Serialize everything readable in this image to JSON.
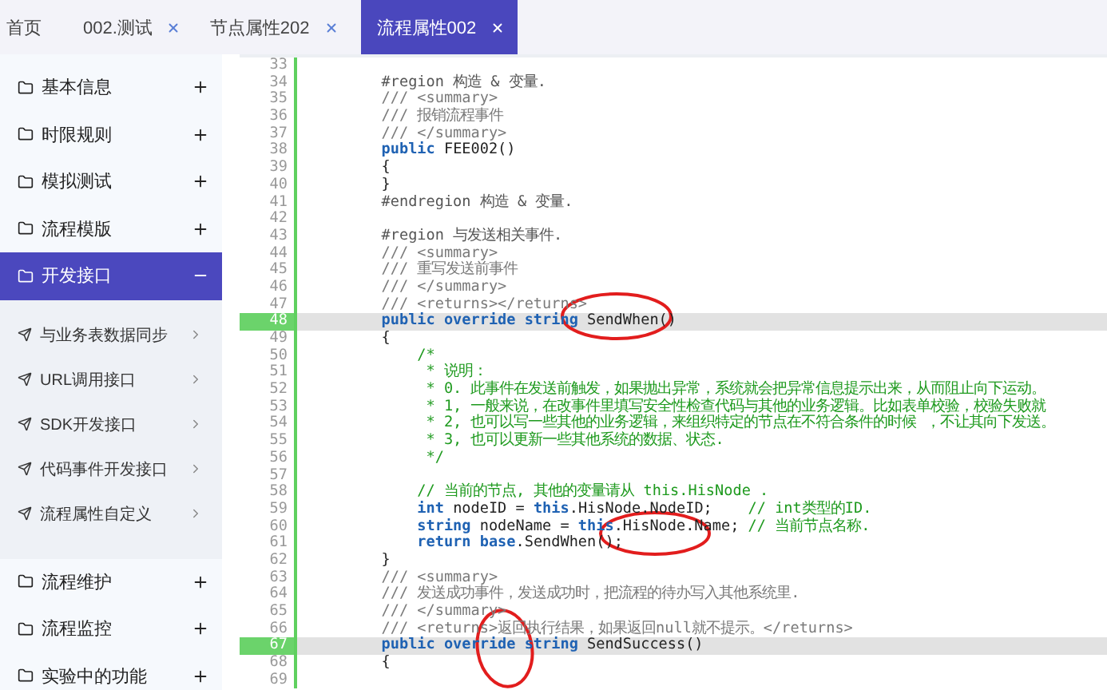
{
  "tabs": [
    {
      "label": "首页",
      "selected": false,
      "closable": false
    },
    {
      "label": "002.测试",
      "selected": false,
      "closable": true
    },
    {
      "label": "节点属性202",
      "selected": false,
      "closable": true
    },
    {
      "label": "流程属性002",
      "selected": true,
      "closable": true
    }
  ],
  "sidebar": {
    "items": [
      {
        "label": "基本信息",
        "expanded": false
      },
      {
        "label": "时限规则",
        "expanded": false
      },
      {
        "label": "模拟测试",
        "expanded": false
      },
      {
        "label": "流程模版",
        "expanded": false
      },
      {
        "label": "开发接口",
        "expanded": true,
        "children": [
          {
            "label": "与业务表数据同步"
          },
          {
            "label": "URL调用接口"
          },
          {
            "label": "SDK开发接口"
          },
          {
            "label": "代码事件开发接口"
          },
          {
            "label": "流程属性自定义"
          }
        ]
      },
      {
        "label": "流程维护",
        "expanded": false
      },
      {
        "label": "流程监控",
        "expanded": false
      },
      {
        "label": "实验中的功能",
        "expanded": false
      }
    ]
  },
  "code": {
    "lines": [
      {
        "number": "33",
        "highlighted": false
      },
      {
        "number": "34",
        "highlighted": false,
        "segments": [
          {
            "kind": "directive",
            "text": "        #region 构造 & 变量."
          }
        ]
      },
      {
        "number": "35",
        "highlighted": false,
        "segments": [
          {
            "kind": "doc",
            "text": "        /// <summary>"
          }
        ]
      },
      {
        "number": "36",
        "highlighted": false,
        "segments": [
          {
            "kind": "doc",
            "text": "        /// 报销流程事件"
          }
        ]
      },
      {
        "number": "37",
        "highlighted": false,
        "segments": [
          {
            "kind": "doc",
            "text": "        /// </summary>"
          }
        ]
      },
      {
        "number": "38",
        "highlighted": false,
        "segments": [
          {
            "kind": "keyword",
            "text": "        public"
          },
          {
            "kind": "plain",
            "text": " FEE002()"
          }
        ]
      },
      {
        "number": "39",
        "highlighted": false,
        "segments": [
          {
            "kind": "plain",
            "text": "        {"
          }
        ]
      },
      {
        "number": "40",
        "highlighted": false,
        "segments": [
          {
            "kind": "plain",
            "text": "        }"
          }
        ]
      },
      {
        "number": "41",
        "highlighted": false,
        "segments": [
          {
            "kind": "directive",
            "text": "        #endregion 构造 & 变量."
          }
        ]
      },
      {
        "number": "42",
        "highlighted": false
      },
      {
        "number": "43",
        "highlighted": false,
        "segments": [
          {
            "kind": "directive",
            "text": "        #region 与发送相关事件."
          }
        ]
      },
      {
        "number": "44",
        "highlighted": false,
        "segments": [
          {
            "kind": "doc",
            "text": "        /// <summary>"
          }
        ]
      },
      {
        "number": "45",
        "highlighted": false,
        "segments": [
          {
            "kind": "doc",
            "text": "        /// 重写发送前事件"
          }
        ]
      },
      {
        "number": "46",
        "highlighted": false,
        "segments": [
          {
            "kind": "doc",
            "text": "        /// </summary>"
          }
        ]
      },
      {
        "number": "47",
        "highlighted": false,
        "segments": [
          {
            "kind": "doc",
            "text": "        /// <returns></returns>"
          }
        ]
      },
      {
        "number": "48",
        "highlighted": true,
        "segments": [
          {
            "kind": "keyword",
            "text": "        public override string"
          },
          {
            "kind": "plain",
            "text": " SendWhen()"
          }
        ]
      },
      {
        "number": "49",
        "highlighted": false,
        "segments": [
          {
            "kind": "plain",
            "text": "        {"
          }
        ]
      },
      {
        "number": "50",
        "highlighted": false,
        "segments": [
          {
            "kind": "comment",
            "text": "            /*"
          }
        ]
      },
      {
        "number": "51",
        "highlighted": false,
        "segments": [
          {
            "kind": "comment",
            "text": "             * 说明："
          }
        ]
      },
      {
        "number": "52",
        "highlighted": false,
        "segments": [
          {
            "kind": "comment",
            "text": "             * 0. 此事件在发送前触发，如果抛出异常，系统就会把异常信息提示出来，从而阻止向下运动。"
          }
        ]
      },
      {
        "number": "53",
        "highlighted": false,
        "segments": [
          {
            "kind": "comment",
            "text": "             * 1, 一般来说，在改事件里填写安全性检查代码与其他的业务逻辑。比如表单校验，校验失败就"
          }
        ]
      },
      {
        "number": "54",
        "highlighted": false,
        "segments": [
          {
            "kind": "comment",
            "text": "             * 2, 也可以写一些其他的业务逻辑，来组织特定的节点在不符合条件的时候 ，不让其向下发送。"
          }
        ]
      },
      {
        "number": "55",
        "highlighted": false,
        "segments": [
          {
            "kind": "comment",
            "text": "             * 3, 也可以更新一些其他系统的数据、状态."
          }
        ]
      },
      {
        "number": "56",
        "highlighted": false,
        "segments": [
          {
            "kind": "comment",
            "text": "             */"
          }
        ]
      },
      {
        "number": "57",
        "highlighted": false
      },
      {
        "number": "58",
        "highlighted": false,
        "segments": [
          {
            "kind": "comment",
            "text": "            // 当前的节点, 其他的变量请从 this.HisNode ."
          }
        ]
      },
      {
        "number": "59",
        "highlighted": false,
        "segments": [
          {
            "kind": "keyword",
            "text": "            int"
          },
          {
            "kind": "plain",
            "text": " nodeID = "
          },
          {
            "kind": "keyword",
            "text": "this"
          },
          {
            "kind": "plain",
            "text": ".HisNode.NodeID;    "
          },
          {
            "kind": "comment",
            "text": "// int类型的ID."
          }
        ]
      },
      {
        "number": "60",
        "highlighted": false,
        "segments": [
          {
            "kind": "keyword",
            "text": "            string"
          },
          {
            "kind": "plain",
            "text": " nodeName = "
          },
          {
            "kind": "keyword",
            "text": "this"
          },
          {
            "kind": "plain",
            "text": ".HisNode.Name; "
          },
          {
            "kind": "comment",
            "text": "// 当前节点名称."
          }
        ]
      },
      {
        "number": "61",
        "highlighted": false,
        "segments": [
          {
            "kind": "keyword",
            "text": "            return base"
          },
          {
            "kind": "plain",
            "text": ".SendWhen();"
          }
        ]
      },
      {
        "number": "62",
        "highlighted": false,
        "segments": [
          {
            "kind": "plain",
            "text": "        }"
          }
        ]
      },
      {
        "number": "63",
        "highlighted": false,
        "segments": [
          {
            "kind": "doc",
            "text": "        /// <summary>"
          }
        ]
      },
      {
        "number": "64",
        "highlighted": false,
        "segments": [
          {
            "kind": "doc",
            "text": "        /// 发送成功事件，发送成功时，把流程的待办写入其他系统里."
          }
        ]
      },
      {
        "number": "65",
        "highlighted": false,
        "segments": [
          {
            "kind": "doc",
            "text": "        /// </summary>"
          }
        ]
      },
      {
        "number": "66",
        "highlighted": false,
        "segments": [
          {
            "kind": "doc",
            "text": "        /// <returns>返回执行结果，如果返回null就不提示。</returns>"
          }
        ]
      },
      {
        "number": "67",
        "highlighted": true,
        "segments": [
          {
            "kind": "keyword",
            "text": "        public override string"
          },
          {
            "kind": "plain",
            "text": " SendSuccess()"
          }
        ]
      },
      {
        "number": "68",
        "highlighted": false,
        "segments": [
          {
            "kind": "plain",
            "text": "        {"
          }
        ]
      },
      {
        "number": "69",
        "highlighted": false
      }
    ]
  }
}
